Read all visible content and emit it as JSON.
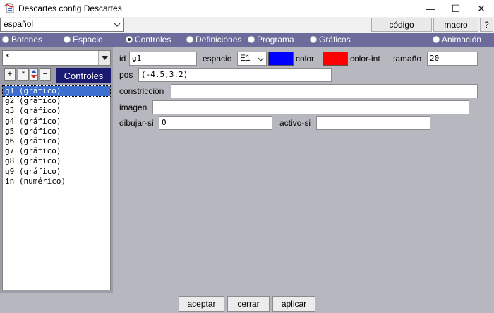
{
  "window": {
    "title": "Descartes config Descartes",
    "controls": {
      "minimize": "—",
      "maximize": "☐",
      "close": "✕"
    }
  },
  "toolbar": {
    "language": "español",
    "codigo_label": "código",
    "macro_label": "macro",
    "help_label": "?"
  },
  "tabs": [
    {
      "label": "Botones",
      "selected": false
    },
    {
      "label": "Espacio",
      "selected": false
    },
    {
      "label": "Controles",
      "selected": true
    },
    {
      "label": "Definiciones",
      "selected": false
    },
    {
      "label": "Programa",
      "selected": false
    },
    {
      "label": "Gráficos",
      "selected": false
    },
    {
      "label": "Animación",
      "selected": false
    }
  ],
  "left": {
    "filter_value": "*",
    "buttons": {
      "add": "+",
      "dup": "*",
      "del": "−"
    },
    "section_label": "Controles",
    "items": [
      {
        "label": "g1 (gráfico)",
        "selected": true
      },
      {
        "label": "g2 (gráfico)",
        "selected": false
      },
      {
        "label": "g3 (gráfico)",
        "selected": false
      },
      {
        "label": "g4 (gráfico)",
        "selected": false
      },
      {
        "label": "g5 (gráfico)",
        "selected": false
      },
      {
        "label": "g6 (gráfico)",
        "selected": false
      },
      {
        "label": "g7 (gráfico)",
        "selected": false
      },
      {
        "label": "g8 (gráfico)",
        "selected": false
      },
      {
        "label": "g9 (gráfico)",
        "selected": false
      },
      {
        "label": "in (numérico)",
        "selected": false
      }
    ]
  },
  "form": {
    "id_label": "id",
    "id_value": "g1",
    "espacio_label": "espacio",
    "espacio_value": "E1",
    "color_label": "color",
    "color_value": "#0000ff",
    "color_int_label": "color-int",
    "color_int_value": "#ff0000",
    "tamano_label": "tamaño",
    "tamano_value": "20",
    "pos_label": "pos",
    "pos_value": "(-4.5,3.2)",
    "constriccion_label": "constricción",
    "constriccion_value": "",
    "imagen_label": "imagen",
    "imagen_value": "",
    "dibujar_si_label": "dibujar-si",
    "dibujar_si_value": "0",
    "activo_si_label": "activo-si",
    "activo_si_value": ""
  },
  "bottom": {
    "aceptar_label": "aceptar",
    "cerrar_label": "cerrar",
    "aplicar_label": "aplicar"
  },
  "colors": {
    "tabbar": "#6b6b9c",
    "left_panel": "#9e9ea8",
    "right_panel": "#b7b7bf",
    "section_label_bg": "#1a1a70",
    "selection": "#3c6fd0"
  }
}
